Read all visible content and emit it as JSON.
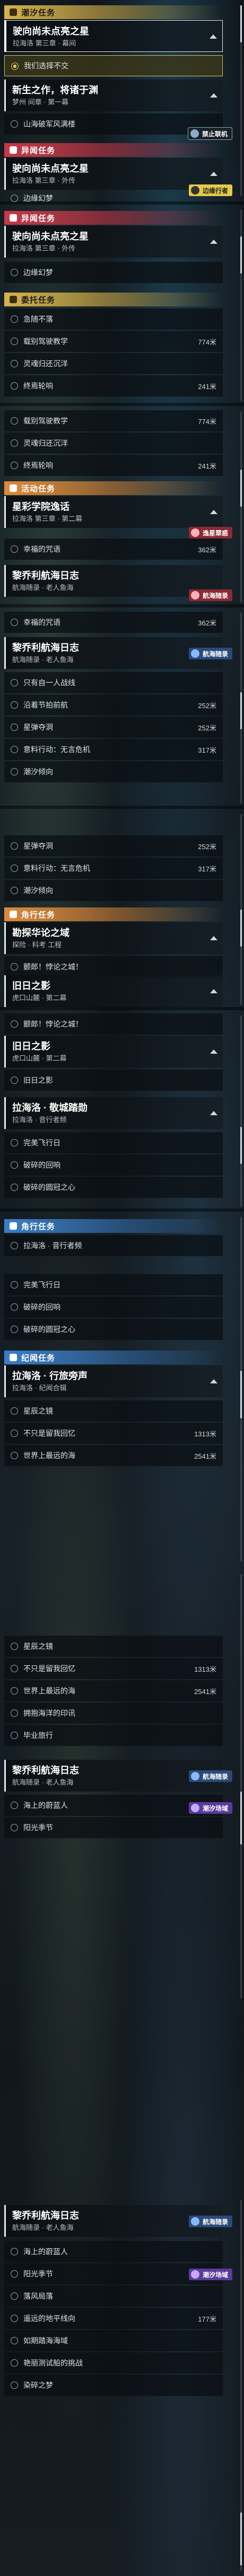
{
  "s1": {
    "cat1": "潮汐任务",
    "card1": {
      "title": "驶向尚未点亮之星",
      "sub": "拉海洛 第三章 · 幕间"
    },
    "row_gold": "我们选择不交",
    "card2": {
      "title": "新生之作，将诸于渊",
      "sub": "梦州 间章 · 第一幕"
    },
    "row2": "山海破军风满楼",
    "badge_forbid": "禁止联机",
    "cat2": "异闻任务",
    "card3": {
      "title": "驶向尚未点亮之星",
      "sub": "拉海洛 第三章 · 外传"
    },
    "row3": "边缘幻梦",
    "badge_edge": "边缘行者"
  },
  "s2": {
    "cat": "异闻任务",
    "card": {
      "title": "驶向尚未点亮之星",
      "sub": "拉海洛 第三章 · 外传"
    },
    "row1": "边缘幻梦",
    "cat2": "委托任务",
    "rows": [
      {
        "text": "急随不落",
        "dist": ""
      },
      {
        "text": "载别驾驶教学",
        "dist": "774米"
      },
      {
        "text": "灵魂归还沉洋",
        "dist": ""
      },
      {
        "text": "终焉轮响",
        "dist": "241米"
      }
    ]
  },
  "s3": {
    "rows": [
      {
        "text": "载别驾驶教学",
        "dist": "774米"
      },
      {
        "text": "灵魂归还沉洋",
        "dist": ""
      },
      {
        "text": "终焉轮响",
        "dist": "241米"
      }
    ],
    "cat": "活动任务",
    "card": {
      "title": "星彩学院逸话",
      "sub": "拉海洛 第三章 · 第二幕"
    },
    "row_star": {
      "text": "幸福的咒语",
      "dist": "362米"
    },
    "badge_star": "逸星翠惑",
    "card2": {
      "title": "黎乔利航海日志",
      "sub": "航海随录 · 老人鱼海"
    },
    "badge_ship": "航海随录"
  },
  "s4": {
    "row0": {
      "text": "幸福的咒语",
      "dist": "362米"
    },
    "card": {
      "title": "黎乔利航海日志",
      "sub": "航海随录 · 老人鱼海"
    },
    "badge_ship": "航海随录",
    "rows": [
      {
        "text": "只有自一人战线",
        "dist": ""
      },
      {
        "text": "沿着节拍前航",
        "dist": "252米"
      },
      {
        "text": "星弹夺洞",
        "dist": "252米"
      },
      {
        "text": "意料行动：无言危机",
        "dist": "317米"
      },
      {
        "text": "潮汐倾向",
        "dist": ""
      }
    ]
  },
  "s5": {
    "rows": [
      {
        "text": "星弹夺洞",
        "dist": "252米"
      },
      {
        "text": "意料行动：无言危机",
        "dist": "317米"
      },
      {
        "text": "潮汐倾向",
        "dist": ""
      }
    ],
    "cat": "角行任务",
    "card1": {
      "title": "勘探华论之域",
      "sub": "探险 · 科考 工程"
    },
    "row1": "颤郎！悖论之城！",
    "card2": {
      "title": "旧日之影",
      "sub": "虎口山麓 · 第二幕"
    }
  },
  "s6": {
    "row0": "颤郎！悖论之城！",
    "card1": {
      "title": "旧日之影",
      "sub": "虎口山麓 · 第二幕"
    },
    "row1": "旧日之影",
    "card2": {
      "title": "拉海洛 · 敬城踏勋",
      "sub": "拉海洛 · 音行者频"
    },
    "rows": [
      {
        "text": "完美飞行日",
        "dist": ""
      },
      {
        "text": "破碎的回响",
        "dist": ""
      },
      {
        "text": "破碎的圆冠之心",
        "dist": ""
      }
    ]
  },
  "s7": {
    "cat": "角行任务",
    "row_top": "拉海洛 · 音行者频",
    "rows": [
      {
        "text": "完美飞行日",
        "dist": ""
      },
      {
        "text": "破碎的回响",
        "dist": ""
      },
      {
        "text": "破碎的圆冠之心",
        "dist": ""
      }
    ],
    "cat2": "纪闻任务",
    "card": {
      "title": "拉海洛 · 行旅旁声",
      "sub": "拉海洛 · 纪闻合辑"
    },
    "rows2": [
      {
        "text": "星辰之镜",
        "dist": ""
      },
      {
        "text": "不只是留我回忆",
        "dist": "1313米"
      },
      {
        "text": "世界上最远的海",
        "dist": "2541米"
      }
    ]
  },
  "s8": {
    "rows": [
      {
        "text": "星辰之镜",
        "dist": ""
      },
      {
        "text": "不只是留我回忆",
        "dist": "1313米"
      },
      {
        "text": "世界上最远的海",
        "dist": "2541米"
      },
      {
        "text": "拥抱海洋的印讯",
        "dist": ""
      },
      {
        "text": "毕业旅行",
        "dist": ""
      }
    ],
    "card": {
      "title": "黎乔利航海日志",
      "sub": "航海随录 · 老人鱼海"
    },
    "badge_ship": "航海随录",
    "row_a": "海上的蔚蓝人",
    "row_b": "阳光季节",
    "badge_tide": "潮汐场域"
  },
  "s9": {
    "card": {
      "title": "黎乔利航海日志",
      "sub": "航海随录 · 老人鱼海"
    },
    "badge_ship": "航海随录",
    "rows": [
      {
        "text": "海上的蔚蓝人",
        "dist": ""
      },
      {
        "text": "阳光季节",
        "dist": ""
      },
      {
        "text": "落风局落",
        "dist": ""
      },
      {
        "text": "遥远的地平线向",
        "dist": ""
      },
      {
        "text": "如期踏海海域",
        "dist": ""
      },
      {
        "text": "艳丽测试船的挑战",
        "dist": ""
      },
      {
        "text": "染碎之梦",
        "dist": ""
      }
    ],
    "badge_tide": "潮汐场域",
    "badge_count": "177米"
  }
}
